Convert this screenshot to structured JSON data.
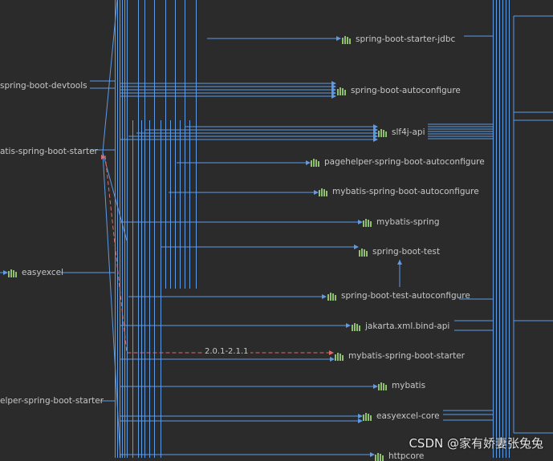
{
  "nodes": {
    "devtools": "spring-boot-devtools",
    "batis_starter_left": "atis-spring-boot-starter",
    "easyexcel": "easyexcel",
    "pagehelper_starter_left": "elper-spring-boot-starter",
    "starter_jdbc": "spring-boot-starter-jdbc",
    "autoconfigure": "spring-boot-autoconfigure",
    "slf4j": "slf4j-api",
    "pagehelper_autoconfigure": "pagehelper-spring-boot-autoconfigure",
    "mybatis_autoconfigure": "mybatis-spring-boot-autoconfigure",
    "mybatis_spring": "mybatis-spring",
    "boot_test": "spring-boot-test",
    "test_autoconfigure": "spring-boot-test-autoconfigure",
    "jakarta": "jakarta.xml.bind-api",
    "mybatis_starter": "mybatis-spring-boot-starter",
    "mybatis": "mybatis",
    "easyexcel_core": "easyexcel-core",
    "bottom_cut": "httpcore"
  },
  "conflict": {
    "label": "2.0.1-2.1.1"
  },
  "watermark": "CSDN @家有娇妻张兔兔",
  "colors": {
    "background": "#2b2b2b",
    "edge": "#5d9be6",
    "conflict": "#e06c6c",
    "text": "#c5c8c6",
    "icon": "#8fbf70"
  }
}
